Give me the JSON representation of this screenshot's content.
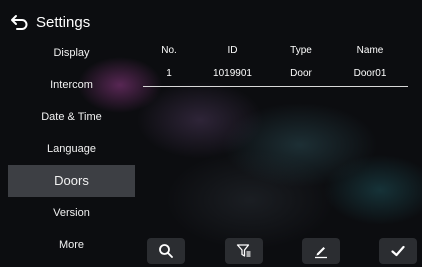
{
  "header": {
    "title": "Settings",
    "back_icon": "back-arrow-icon"
  },
  "sidebar": {
    "items": [
      {
        "label": "Display"
      },
      {
        "label": "Intercom"
      },
      {
        "label": "Date & Time"
      },
      {
        "label": "Language"
      },
      {
        "label": "Doors",
        "active": true
      },
      {
        "label": "Version"
      },
      {
        "label": "More"
      }
    ]
  },
  "table": {
    "headers": {
      "no": "No.",
      "id": "ID",
      "type": "Type",
      "name": "Name"
    },
    "rows": [
      {
        "no": "1",
        "id": "1019901",
        "type": "Door",
        "name": "Door01"
      }
    ]
  },
  "toolbar": {
    "buttons": [
      {
        "icon": "search-icon"
      },
      {
        "icon": "filter-icon"
      },
      {
        "icon": "edit-icon"
      },
      {
        "icon": "confirm-check-icon"
      }
    ]
  },
  "colors": {
    "active_item_bg": "#3d3f44",
    "toolbar_button_bg": "#2b2d31"
  }
}
